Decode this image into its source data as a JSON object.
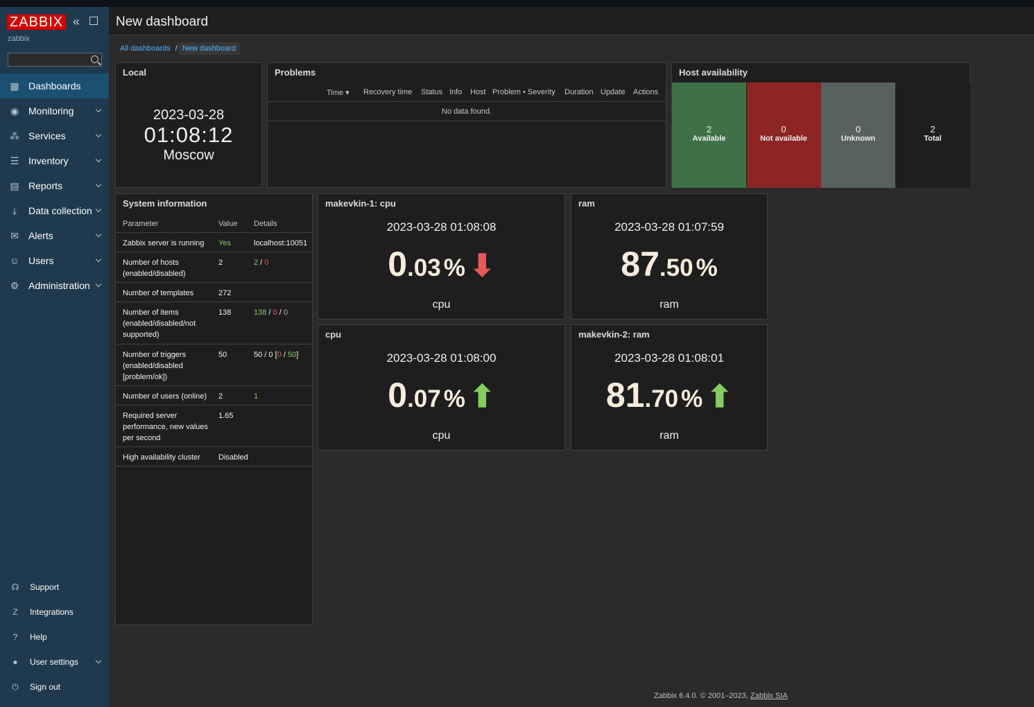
{
  "sidebar": {
    "logo": "ZABBIX",
    "username": "zabbix",
    "search_value": "",
    "menu": [
      {
        "label": "Dashboards",
        "icon": "dashboard-icon",
        "glyph": "▦"
      },
      {
        "label": "Monitoring",
        "icon": "eye-icon",
        "glyph": "◉"
      },
      {
        "label": "Services",
        "icon": "services-icon",
        "glyph": "⁂"
      },
      {
        "label": "Inventory",
        "icon": "list-icon",
        "glyph": "☰"
      },
      {
        "label": "Reports",
        "icon": "report-icon",
        "glyph": "▤"
      },
      {
        "label": "Data collection",
        "icon": "download-icon",
        "glyph": "⤓"
      },
      {
        "label": "Alerts",
        "icon": "envelope-icon",
        "glyph": "✉"
      },
      {
        "label": "Users",
        "icon": "users-icon",
        "glyph": "☺"
      },
      {
        "label": "Administration",
        "icon": "gear-icon",
        "glyph": "⚙"
      }
    ],
    "bottom_menu": [
      {
        "label": "Support",
        "icon": "headset-icon",
        "glyph": "☊"
      },
      {
        "label": "Integrations",
        "icon": "integrations-icon",
        "glyph": "Z"
      },
      {
        "label": "Help",
        "icon": "help-icon",
        "glyph": "?"
      },
      {
        "label": "User settings",
        "icon": "user-icon",
        "glyph": "●"
      },
      {
        "label": "Sign out",
        "icon": "power-icon",
        "glyph": "⏻"
      }
    ]
  },
  "header": {
    "title": "New dashboard"
  },
  "breadcrumb": {
    "all": "All dashboards",
    "sep": "/",
    "current": "New dashboard"
  },
  "clock": {
    "title": "Local",
    "date": "2023-03-28",
    "time": "01:08:12",
    "timezone": "Moscow"
  },
  "problems": {
    "title": "Problems",
    "columns": [
      "Time ▾",
      "Recovery time",
      "Status",
      "Info",
      "Host",
      "Problem • Severity",
      "Duration",
      "Update",
      "Actions"
    ],
    "empty": "No data found."
  },
  "host_availability": {
    "title": "Host availability",
    "cells": [
      {
        "value": "2",
        "label": "Available",
        "color": "#3f7147"
      },
      {
        "value": "0",
        "label": "Not available",
        "color": "#8c2523"
      },
      {
        "value": "0",
        "label": "Unknown",
        "color": "#59615f"
      },
      {
        "value": "2",
        "label": "Total",
        "color": "#1e1e1e"
      }
    ]
  },
  "system_info": {
    "title": "System information",
    "headers": {
      "param": "Parameter",
      "value": "Value",
      "details": "Details"
    },
    "rows": [
      {
        "param": "Zabbix server is running",
        "value": "Yes",
        "details": "localhost:10051"
      },
      {
        "param": "Number of hosts (enabled/disabled)",
        "value": "2",
        "d1": "2",
        "s1": " / ",
        "d2": "0"
      },
      {
        "param": "Number of templates",
        "value": "272"
      },
      {
        "param": "Number of items (enabled/disabled/not supported)",
        "value": "138",
        "d1": "138",
        "s1": " / ",
        "d2": "0",
        "s2": " / ",
        "d3": "0"
      },
      {
        "param": "Number of triggers (enabled/disabled [problem/ok])",
        "value": "50",
        "d0": "50 / 0 [",
        "d2": "0",
        "s2": " / ",
        "d1": "50",
        "s3": "]"
      },
      {
        "param": "Number of users (online)",
        "value": "2",
        "d1": "1"
      },
      {
        "param": "Required server performance, new values per second",
        "value": "1.65"
      },
      {
        "param": "High availability cluster",
        "value": "Disabled"
      }
    ]
  },
  "item_values": [
    {
      "title": "makevkin-1: cpu",
      "time": "2023-03-28 01:08:08",
      "int": "0",
      "dec": ".03",
      "unit": "%",
      "arrow": "⬇",
      "arrow_color": "#e45959",
      "name": "cpu"
    },
    {
      "title": "ram",
      "time": "2023-03-28 01:07:59",
      "int": "87",
      "dec": ".50",
      "unit": "%",
      "arrow": "",
      "arrow_color": "#86cc63",
      "name": "ram"
    },
    {
      "title": "cpu",
      "time": "2023-03-28 01:08:00",
      "int": "0",
      "dec": ".07",
      "unit": "%",
      "arrow": "⬆",
      "arrow_color": "#86cc63",
      "name": "cpu"
    },
    {
      "title": "makevkin-2: ram",
      "time": "2023-03-28 01:08:01",
      "int": "81",
      "dec": ".70",
      "unit": "%",
      "arrow": "⬆",
      "arrow_color": "#86cc63",
      "name": "ram"
    }
  ],
  "footer": {
    "text": "Zabbix 6.4.0. © 2001–2023, ",
    "link": "Zabbix SIA"
  }
}
